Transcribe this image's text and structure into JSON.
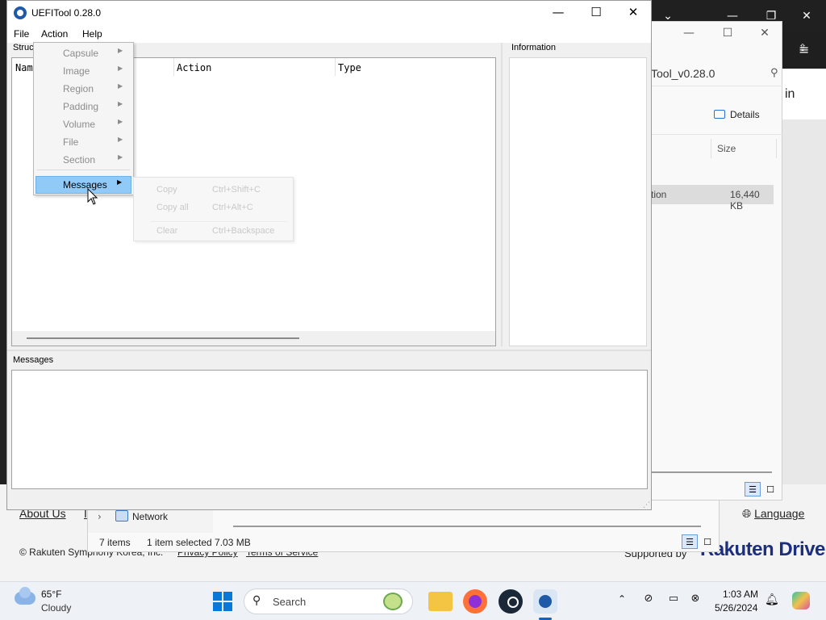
{
  "colors": {
    "menu_highlight": "#91c9f7",
    "brand_blue": "#1d2f7c",
    "taskbar": "#eef1f6"
  },
  "background_page": {
    "footer_links": [
      "About Us",
      "Language"
    ],
    "footer_cut": "I",
    "copyright": "© Rakuten Symphony Korea, Inc.",
    "privacy": "Privacy Policy",
    "terms": "Terms of Service",
    "supported_by": "Supported by",
    "brand": "Rakuten Drive",
    "side_text": "in"
  },
  "explorer": {
    "address_text": "Tool_v0.28.0",
    "details_label": "Details",
    "col_size": "Size",
    "row_type": "tion",
    "row_size": "16,440 KB",
    "nav_network": "Network",
    "status_items": "7 items",
    "status_selected": "1 item selected  7.03 MB"
  },
  "uefitool": {
    "title": "UEFITool 0.28.0",
    "menu": {
      "file": "File",
      "action": "Action",
      "help": "Help"
    },
    "structure_label": "Struc",
    "information_label": "Information",
    "messages_label": "Messages",
    "tree_columns": {
      "name": "Name",
      "action": "Action",
      "type": "Type"
    }
  },
  "action_menu": {
    "items": [
      {
        "label": "Capsule"
      },
      {
        "label": "Image"
      },
      {
        "label": "Region"
      },
      {
        "label": "Padding"
      },
      {
        "label": "Volume"
      },
      {
        "label": "File"
      },
      {
        "label": "Section"
      }
    ],
    "messages": "Messages"
  },
  "messages_submenu": {
    "copy": "Copy",
    "copy_shortcut": "Ctrl+Shift+C",
    "copy_all": "Copy all",
    "copy_all_shortcut": "Ctrl+Alt+C",
    "clear": "Clear",
    "clear_shortcut": "Ctrl+Backspace"
  },
  "taskbar": {
    "weather_temp": "65°F",
    "weather_cond": "Cloudy",
    "search_placeholder": "Search",
    "time": "1:03 AM",
    "date": "5/26/2024",
    "icons": [
      "folder-icon",
      "firefox-icon",
      "steam-icon",
      "uefitool-icon"
    ]
  }
}
